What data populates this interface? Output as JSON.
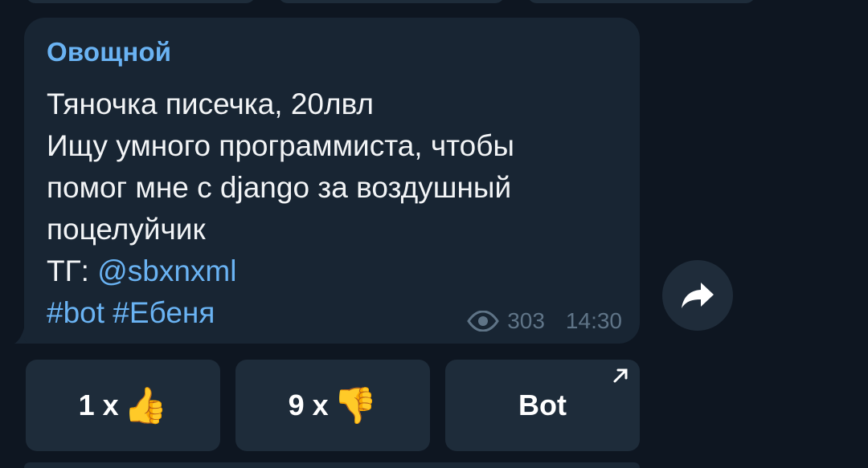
{
  "message": {
    "author": "Овощной",
    "lines": [
      "Тяночка писечка, 20лвл",
      "Ищу умного программиста, чтобы",
      "помог мне с django за воздушный",
      "поцелуйчик"
    ],
    "contact_prefix": "ТГ: ",
    "contact_handle": "@sbxnxml",
    "hashtags": [
      "#bot",
      "#Ебеня"
    ],
    "views": "303",
    "time": "14:30"
  },
  "icons": {
    "views": "eye-icon",
    "forward": "forward-arrow-icon",
    "external": "external-link-arrow-icon"
  },
  "keyboard": {
    "like_label": "1 x",
    "like_emoji": "👍",
    "dislike_label": "9 x",
    "dislike_emoji": "👎",
    "bot_label": "Bot"
  },
  "colors": {
    "background": "#0e1621",
    "bubble": "#182533",
    "accent": "#6ab3f3",
    "button": "#1e2c3a",
    "meta": "#5f7487"
  }
}
